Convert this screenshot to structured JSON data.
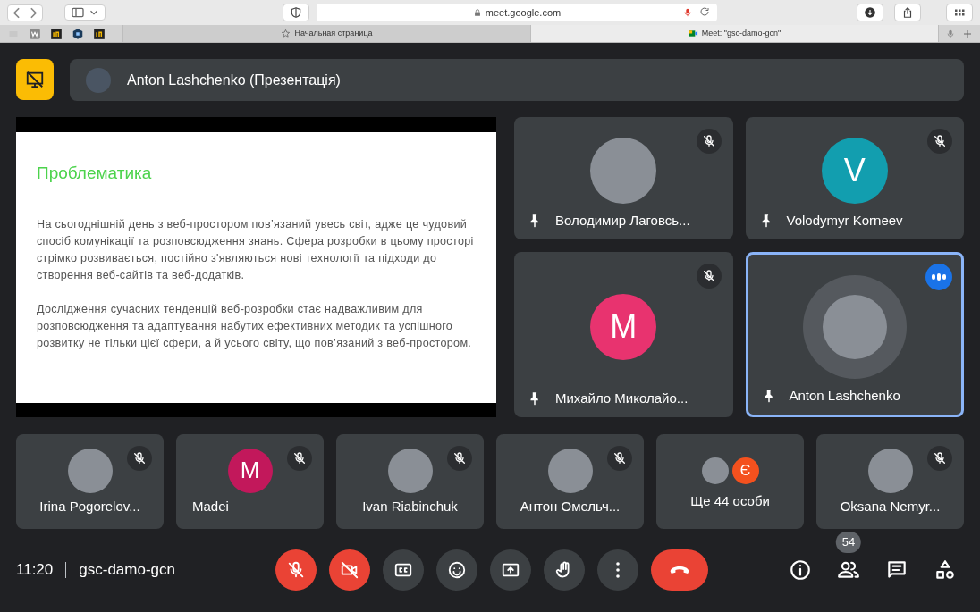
{
  "browser": {
    "url": "meet.google.com",
    "tabs": [
      {
        "title": "Начальная страница",
        "kind": "start",
        "selected": false
      },
      {
        "title": "Meet: \"gsc-damo-gcn\"",
        "kind": "meet",
        "selected": true
      }
    ]
  },
  "presenter": {
    "name": "Anton Lashchenko (Презентація)"
  },
  "slide": {
    "title": "Проблематика",
    "paragraphs": [
      "На сьогоднішній день з веб-простором пов’язаний увесь світ, адже це чудовий спосіб комунікації та розповсюдження знань. Сфера розробки в цьому просторі стрімко розвивається, постійно з'являються нові технології та підходи до створення веб-сайтів та веб-додатків.",
      "Дослідження сучасних тенденцій веб-розробки стає надважливим для розповсюдження та адаптування набутих ефективних методик та успішного розвитку не тільки цієї сфери, а й усього світу, що пов’язаний з веб-простором."
    ]
  },
  "main_tiles": [
    {
      "name": "Володимир Лаговсь...",
      "avatar": {
        "kind": "photo"
      },
      "muted": true,
      "speaking": false
    },
    {
      "name": "Volodymyr Korneev",
      "avatar": {
        "kind": "letter",
        "letter": "V",
        "color": "#129eaf"
      },
      "muted": true,
      "speaking": false
    },
    {
      "name": "Михайло Миколайо...",
      "avatar": {
        "kind": "letter",
        "letter": "M",
        "color": "#e8336f"
      },
      "muted": true,
      "speaking": false
    },
    {
      "name": "Anton Lashchenko",
      "avatar": {
        "kind": "photo"
      },
      "muted": false,
      "speaking": true
    }
  ],
  "small_tiles": [
    {
      "kind": "person",
      "name": "Irina Pogorelov...",
      "avatar": {
        "kind": "photo"
      },
      "muted": true
    },
    {
      "kind": "person",
      "name": "Madei",
      "avatar": {
        "kind": "letter",
        "letter": "M",
        "color": "#c2185b"
      },
      "muted": true
    },
    {
      "kind": "person",
      "name": "Ivan Riabinchuk",
      "avatar": {
        "kind": "photo"
      },
      "muted": true
    },
    {
      "kind": "person",
      "name": "Антон Омельч...",
      "avatar": {
        "kind": "photo"
      },
      "muted": true
    },
    {
      "kind": "overflow",
      "name": "Ще 44 особи",
      "letter": "Є",
      "color": "#f4511e"
    },
    {
      "kind": "person",
      "name": "Oksana Nemyr...",
      "avatar": {
        "kind": "photo"
      },
      "muted": true
    }
  ],
  "footer": {
    "time": "11:20",
    "code": "gsc-damo-gcn",
    "participants_count": "54"
  },
  "controls": [
    {
      "kind": "mic",
      "off": true
    },
    {
      "kind": "camera",
      "off": true
    },
    {
      "kind": "captions",
      "off": false
    },
    {
      "kind": "emoji",
      "off": false
    },
    {
      "kind": "present",
      "off": false
    },
    {
      "kind": "hand",
      "off": false
    },
    {
      "kind": "more",
      "off": false
    },
    {
      "kind": "hangup"
    }
  ]
}
